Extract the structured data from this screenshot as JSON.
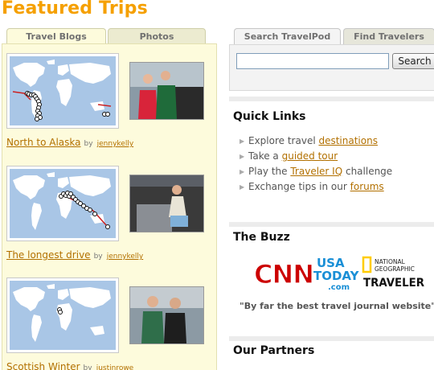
{
  "featured": {
    "title": "Featured Trips",
    "tabs": [
      {
        "label": "Travel Blogs",
        "active": true
      },
      {
        "label": "Photos",
        "active": false
      }
    ],
    "trips": [
      {
        "title": "North to Alaska",
        "by": "by",
        "author": "jennykelly"
      },
      {
        "title": "The longest drive",
        "by": "by",
        "author": "jennykelly"
      },
      {
        "title": "Scottish Winter",
        "by": "by",
        "author": "justinrowe"
      }
    ]
  },
  "search": {
    "tabs": [
      {
        "label": "Search TravelPod",
        "active": true
      },
      {
        "label": "Find Travelers",
        "active": false
      }
    ],
    "input_value": "",
    "button_label": "Search"
  },
  "quick_links": {
    "heading": "Quick Links",
    "items": [
      {
        "prefix": "Explore travel ",
        "link": "destinations",
        "suffix": ""
      },
      {
        "prefix": "Take a ",
        "link": "guided tour",
        "suffix": ""
      },
      {
        "prefix": "Play the ",
        "link": "Traveler IQ",
        "suffix": " challenge"
      },
      {
        "prefix": "Exchange tips in our ",
        "link": "forums",
        "suffix": ""
      }
    ]
  },
  "buzz": {
    "heading": "The Buzz",
    "logos": {
      "cnn": "CNN",
      "usa_today": [
        "USA",
        "TODAY",
        ".com"
      ],
      "natgeo": [
        "NATIONAL",
        "GEOGRAPHIC",
        "TRAVELER"
      ]
    },
    "quote": "\"By far the best travel journal website\""
  },
  "partners": {
    "heading": "Our Partners"
  },
  "colors": {
    "accent": "#f5a000",
    "link": "#b27000",
    "panel": "#fdfbdc",
    "cnn_red": "#cc0000",
    "usa_blue": "#1a8fd6",
    "natgeo_yellow": "#ffcc00"
  }
}
